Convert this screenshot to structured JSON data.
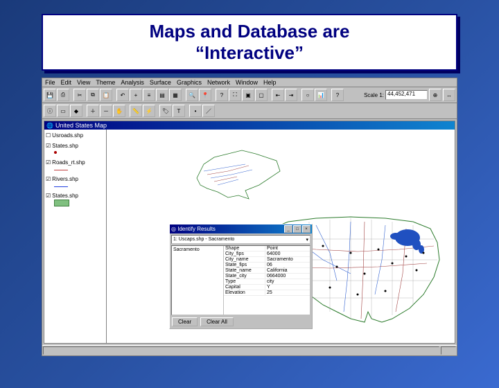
{
  "slide": {
    "title_line1": "Maps and Database are",
    "title_line2": "“Interactive”"
  },
  "menubar": [
    "File",
    "Edit",
    "View",
    "Theme",
    "Analysis",
    "Surface",
    "Graphics",
    "Network",
    "Window",
    "Help"
  ],
  "toolbar": {
    "scale_label": "Scale 1:",
    "scale_value": "44,452,471"
  },
  "map_window_title": "United States Map",
  "layers": [
    {
      "name": "Usroads.shp",
      "checked": false,
      "style": "none"
    },
    {
      "name": "States.shp",
      "checked": true,
      "style": "dot"
    },
    {
      "name": "Roads_rt.shp",
      "checked": true,
      "style": "line-red"
    },
    {
      "name": "Rivers.shp",
      "checked": true,
      "style": "line-blue"
    },
    {
      "name": "States.shp",
      "checked": true,
      "style": "rect-green"
    }
  ],
  "identify": {
    "title": "Identify Results",
    "combo": "1: Uscaps.shp - Sacramento",
    "tree_root": "Sacramento",
    "fields": [
      {
        "k": "Shape",
        "v": "Point"
      },
      {
        "k": "City_fips",
        "v": "64000"
      },
      {
        "k": "City_name",
        "v": "Sacramento"
      },
      {
        "k": "State_fips",
        "v": "06"
      },
      {
        "k": "State_name",
        "v": "California"
      },
      {
        "k": "State_city",
        "v": "0664000"
      },
      {
        "k": "Type",
        "v": "city"
      },
      {
        "k": "Capital",
        "v": "Y"
      },
      {
        "k": "Elevation",
        "v": "25"
      }
    ],
    "btn_clear": "Clear",
    "btn_clear_all": "Clear All"
  }
}
